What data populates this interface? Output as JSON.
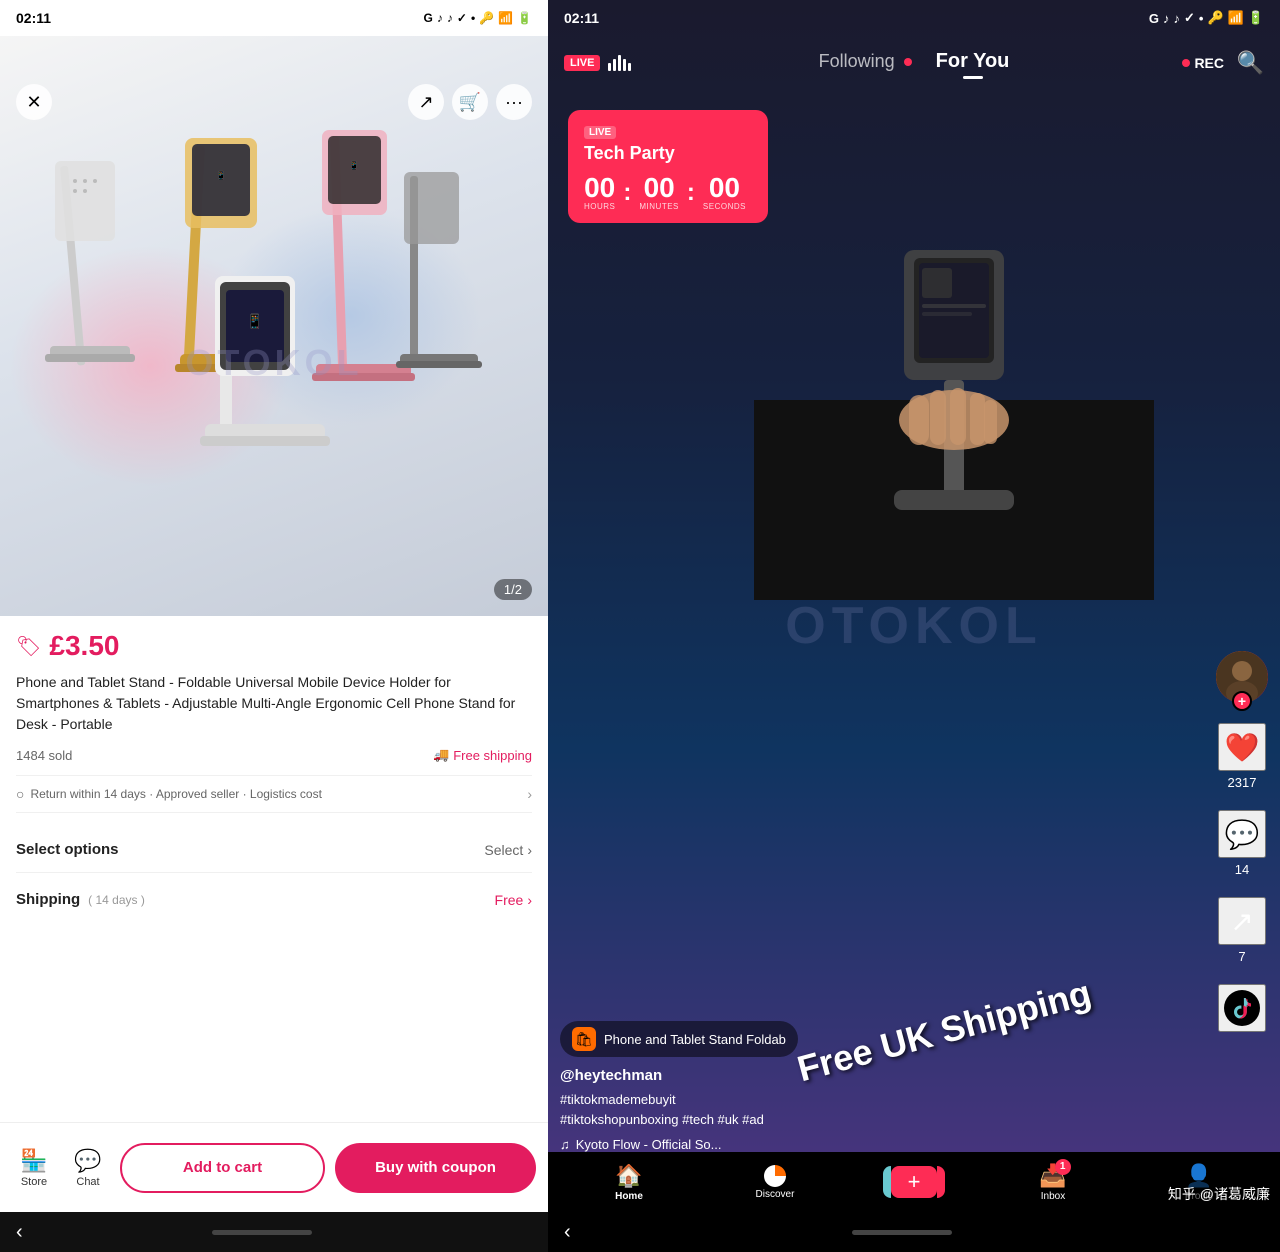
{
  "left": {
    "statusBar": {
      "time": "02:11",
      "icons": "G ♪ ♪ ✓ •"
    },
    "header": {
      "closeBtn": "✕",
      "shareBtn": "↗",
      "cartBtn": "🛒",
      "moreBtn": "···"
    },
    "image": {
      "counter": "1/2",
      "watermark": "OTOKOL"
    },
    "price": "£3.50",
    "priceIcon": "🏷",
    "title": "Phone and Tablet Stand - Foldable Universal Mobile Device Holder for Smartphones & Tablets - Adjustable Multi-Angle Ergonomic Cell Phone Stand for Desk - Portable",
    "soldCount": "1484 sold",
    "freeShipping": "Free shipping",
    "returnText": "Return within 14 days · Approved seller · Logistics cost",
    "selectOptions": {
      "label": "Select options",
      "btn": "Select"
    },
    "shipping": {
      "label": "Shipping",
      "days": "( 14 days )",
      "value": "Free"
    },
    "bottomBar": {
      "store": "Store",
      "chat": "Chat",
      "addToCart": "Add to cart",
      "buyWithCoupon": "Buy with coupon"
    },
    "systemBar": {
      "backBtn": "‹",
      "homeIndicator": ""
    }
  },
  "right": {
    "statusBar": {
      "time": "02:11",
      "icons": "G ♪ ♪ ✓ •"
    },
    "topNav": {
      "live": "LIVE",
      "following": "Following",
      "forYou": "For You",
      "rec": "REC"
    },
    "liveCard": {
      "liveBadge": "LIVE",
      "title": "Tech Party",
      "hours": "00",
      "minutes": "00",
      "seconds": "00",
      "hoursLabel": "HOURS",
      "minutesLabel": "MINUTES",
      "secondsLabel": "SECONDS"
    },
    "freeShippingText": "Free UK Shipping",
    "watermark": "OTOKOL",
    "actions": {
      "likes": "2317",
      "comments": "14",
      "shares": "7"
    },
    "productPill": "Phone and Tablet Stand  Foldab",
    "username": "@heytechman",
    "hashtags": "#tiktokmademebuyit\n#tiktokshopunboxing #tech #uk #ad",
    "music": "Kyoto Flow - Official So...",
    "bottomNav": {
      "home": "Home",
      "discover": "Discover",
      "inbox": "Inbox",
      "profile": "Profile",
      "inboxBadge": "1"
    },
    "zhihu": "知乎 @诸葛威廉",
    "systemBar": {
      "backBtn": "‹"
    }
  }
}
